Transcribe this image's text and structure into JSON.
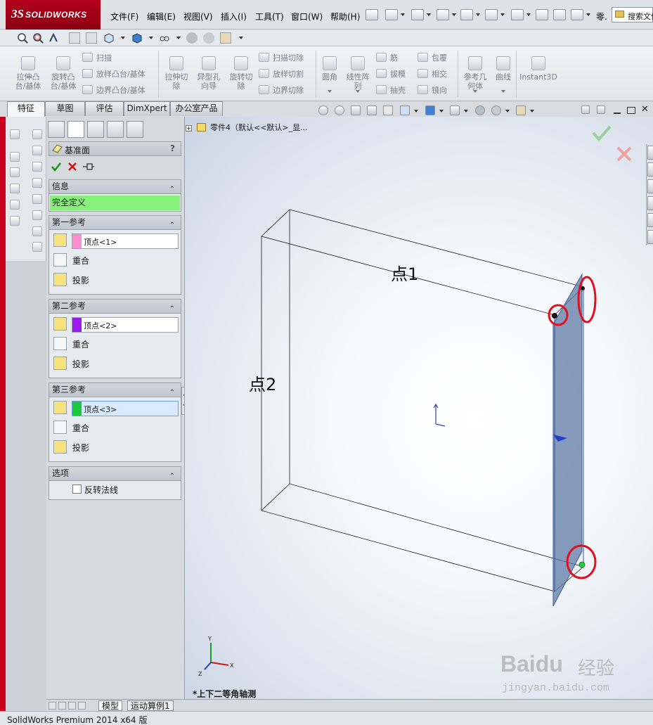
{
  "app": {
    "logo_text": "SOLIDWORKS",
    "menus": [
      "文件(F)",
      "编辑(E)",
      "视图(V)",
      "插入(I)",
      "工具(T)",
      "窗口(W)",
      "帮助(H)"
    ],
    "tail_text": "零.",
    "search_text": "搜索文件"
  },
  "command_manager": {
    "big_buttons": [
      "拉伸凸\n台/基体",
      "旋转凸\n台/基体",
      "拉伸切\n除",
      "异型孔\n向导",
      "旋转切\n除",
      "圆角",
      "线性阵\n列",
      "参考几\n何体",
      "曲线",
      "Instant3D"
    ],
    "small_buttons": [
      "扫描",
      "放样凸台/基体",
      "边界凸台/基体",
      "扫描切除",
      "放样切割",
      "边界切除",
      "筋",
      "拔模",
      "抽壳",
      "包覆",
      "相交",
      "镜向"
    ]
  },
  "tabs": [
    "特征",
    "草图",
    "评估",
    "DimXpert",
    "办公室产品"
  ],
  "property_manager": {
    "title": "基准面",
    "help": "?",
    "info": {
      "header": "信息",
      "status": "完全定义",
      "status_color": "#86f07a"
    },
    "references": [
      {
        "header": "第一参考",
        "value": "顶点<1>",
        "swatch": "#ff8ccd",
        "opts": [
          "重合",
          "投影"
        ]
      },
      {
        "header": "第二参考",
        "value": "顶点<2>",
        "swatch": "#9b1cf0",
        "opts": [
          "重合",
          "投影"
        ]
      },
      {
        "header": "第三参考",
        "value": "顶点<3>",
        "swatch": "#1cc83c",
        "opts": [
          "重合",
          "投影"
        ]
      }
    ],
    "options": {
      "header": "选项",
      "flip_normal": "反转法线",
      "flip_checked": false
    }
  },
  "viewport": {
    "tree_root": "零件4（默认<<默认>_显...",
    "label_point1": "点1",
    "label_point2": "点2",
    "view_name": "*上下二等角轴测",
    "triad": {
      "x": "X",
      "y": "Y",
      "z": "Z"
    },
    "circle_color": "#e0101e"
  },
  "bottom_tabs": [
    "模型",
    "运动算例1"
  ],
  "status": "SolidWorks Premium 2014 x64 版",
  "watermark": {
    "brand": "Baidu",
    "sub": "经验",
    "url": "jingyan.baidu.com"
  }
}
